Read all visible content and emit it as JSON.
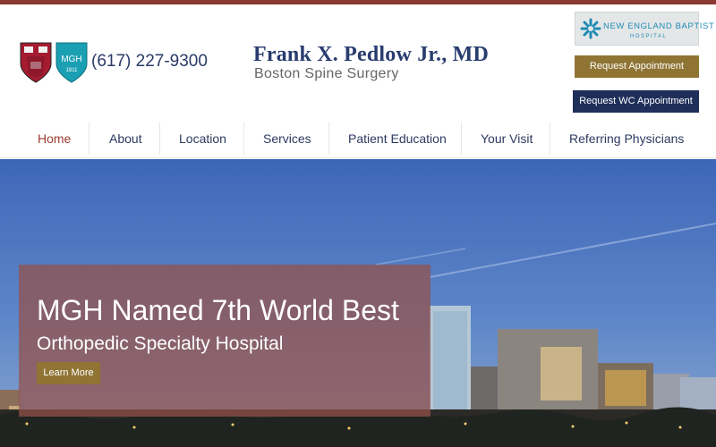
{
  "header": {
    "phone": "(617) 227-9300",
    "brand_name": "Frank X. Pedlow Jr., MD",
    "brand_subtitle": "Boston Spine Surgery",
    "partner_logo": {
      "name": "NEW ENGLAND BAPTIST",
      "subtitle": "HOSPITAL"
    },
    "request_appointment": "Request Appointment",
    "request_wc_appointment": "Request WC Appointment",
    "icons": [
      "harvard-shield-icon",
      "mgh-shield-icon",
      "neb-star-icon"
    ],
    "mgh_shield": {
      "line1": "MGH",
      "line2": "1811"
    }
  },
  "nav": {
    "items": [
      {
        "label": "Home",
        "active": true
      },
      {
        "label": "About",
        "active": false
      },
      {
        "label": "Location",
        "active": false
      },
      {
        "label": "Services",
        "active": false
      },
      {
        "label": "Patient Education",
        "active": false
      },
      {
        "label": "Your Visit",
        "active": false
      },
      {
        "label": "Referring Physicians",
        "active": false
      }
    ]
  },
  "hero": {
    "title": "MGH Named 7th World Best",
    "subtitle": "Orthopedic Specialty Hospital",
    "cta": "Learn More"
  },
  "colors": {
    "top_bar": "#8a3a30",
    "brand_navy": "#283c6e",
    "gold_button": "#8f7434",
    "navy_button": "#1f2f5a",
    "active_nav": "#9b3c2e",
    "overlay": "rgba(150,80,72,0.72)"
  }
}
